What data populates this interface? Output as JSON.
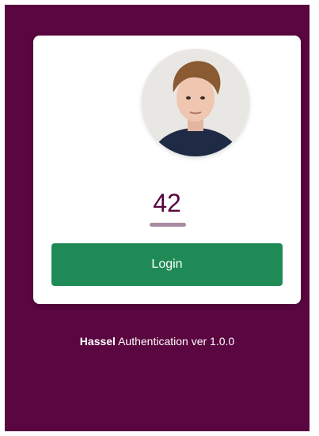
{
  "theme": {
    "background_color": "#5a0640",
    "card_color": "#ffffff",
    "button_color": "#1f8a55",
    "accent_color": "#a98aa0"
  },
  "profile": {
    "avatar_icon": "user-avatar-photo"
  },
  "pin": {
    "value": "42"
  },
  "login": {
    "button_label": "Login"
  },
  "footer": {
    "brand": "Hassel",
    "text": "Authentication ver 1.0.0"
  }
}
